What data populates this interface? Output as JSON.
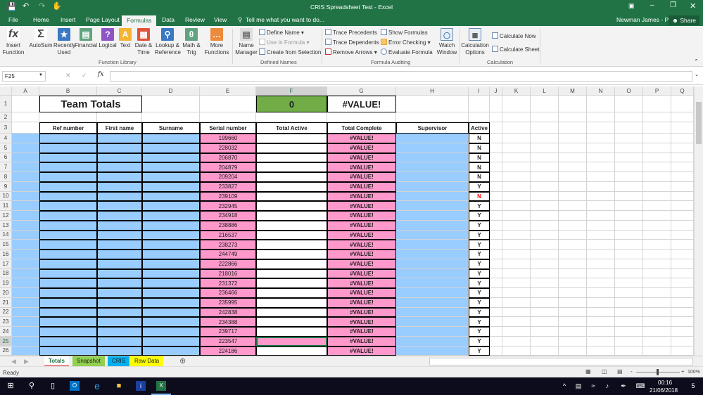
{
  "window": {
    "title": "CRIS Spreadsheet Test - Excel",
    "user": "Newman James - PY",
    "share": "Share"
  },
  "ribbon_tabs": [
    "File",
    "Home",
    "Insert",
    "Page Layout",
    "Formulas",
    "Data",
    "Review",
    "View"
  ],
  "active_tab": "Formulas",
  "tell_me": "Tell me what you want to do...",
  "function_library": {
    "label": "Function Library",
    "buttons": [
      {
        "label": "Insert\nFunction",
        "icon": "fx-icon",
        "color": "#ffffff"
      },
      {
        "label": "AutoSum",
        "icon": "sigma-icon",
        "color": "#ffffff"
      },
      {
        "label": "Recently\nUsed",
        "icon": "star-book-icon",
        "color": "#3a78c3"
      },
      {
        "label": "Financial",
        "icon": "financial-book-icon",
        "color": "#5fa37f"
      },
      {
        "label": "Logical",
        "icon": "question-book-icon",
        "color": "#8e55c7"
      },
      {
        "label": "Text",
        "icon": "text-book-icon",
        "color": "#f5b431"
      },
      {
        "label": "Date &\nTime",
        "icon": "calendar-book-icon",
        "color": "#e0533a"
      },
      {
        "label": "Lookup &\nReference",
        "icon": "magnifier-book-icon",
        "color": "#3a78c3"
      },
      {
        "label": "Math &\nTrig",
        "icon": "theta-book-icon",
        "color": "#5fa37f"
      },
      {
        "label": "More\nFunctions",
        "icon": "more-book-icon",
        "color": "#ec8b3c"
      }
    ]
  },
  "defined_names": {
    "label": "Defined Names",
    "name_manager": "Name\nManager",
    "define_name": "Define Name",
    "use_in_formula": "Use in Formula",
    "create_from_selection": "Create from Selection"
  },
  "formula_auditing": {
    "label": "Formula Auditing",
    "trace_precedents": "Trace Precedents",
    "trace_dependents": "Trace Dependents",
    "remove_arrows": "Remove Arrows",
    "show_formulas": "Show Formulas",
    "error_checking": "Error Checking",
    "evaluate_formula": "Evaluate Formula",
    "watch_window": "Watch\nWindow"
  },
  "calculation": {
    "label": "Calculation",
    "options": "Calculation\nOptions",
    "calc_now": "Calculate Now",
    "calc_sheet": "Calculate Sheet"
  },
  "formula_bar": {
    "name_box": "F25",
    "formula": ""
  },
  "columns": [
    "A",
    "B",
    "C",
    "D",
    "E",
    "F",
    "G",
    "H",
    "I",
    "J",
    "K",
    "L",
    "M",
    "N",
    "O",
    "P",
    "Q"
  ],
  "selected_cell": "F25",
  "sheet": {
    "title": "Team Totals",
    "total_active": "0",
    "total_complete": "#VALUE!",
    "headers": [
      "Ref number",
      "First name",
      "Surname",
      "Serial number",
      "Total Active",
      "Total Complete",
      "Supervisor",
      "Active"
    ],
    "rows": [
      {
        "serial": "199660",
        "complete": "#VALUE!",
        "active": "N"
      },
      {
        "serial": "228032",
        "complete": "#VALUE!",
        "active": "N"
      },
      {
        "serial": "206870",
        "complete": "#VALUE!",
        "active": "N"
      },
      {
        "serial": "204879",
        "complete": "#VALUE!",
        "active": "N"
      },
      {
        "serial": "209204",
        "complete": "#VALUE!",
        "active": "N"
      },
      {
        "serial": "233827",
        "complete": "#VALUE!",
        "active": "Y"
      },
      {
        "serial": "239109",
        "complete": "#VALUE!",
        "active": "N",
        "active_color": "#ff0000"
      },
      {
        "serial": "232945",
        "complete": "#VALUE!",
        "active": "Y"
      },
      {
        "serial": "234918",
        "complete": "#VALUE!",
        "active": "Y"
      },
      {
        "serial": "238886",
        "complete": "#VALUE!",
        "active": "Y"
      },
      {
        "serial": "216537",
        "complete": "#VALUE!",
        "active": "Y"
      },
      {
        "serial": "238273",
        "complete": "#VALUE!",
        "active": "Y"
      },
      {
        "serial": "244749",
        "complete": "#VALUE!",
        "active": "Y"
      },
      {
        "serial": "222866",
        "complete": "#VALUE!",
        "active": "Y"
      },
      {
        "serial": "218016",
        "complete": "#VALUE!",
        "active": "Y"
      },
      {
        "serial": "231372",
        "complete": "#VALUE!",
        "active": "Y"
      },
      {
        "serial": "236466",
        "complete": "#VALUE!",
        "active": "Y"
      },
      {
        "serial": "235995",
        "complete": "#VALUE!",
        "active": "Y"
      },
      {
        "serial": "242838",
        "complete": "#VALUE!",
        "active": "Y"
      },
      {
        "serial": "234388",
        "complete": "#VALUE!",
        "active": "Y"
      },
      {
        "serial": "239717",
        "complete": "#VALUE!",
        "active": "Y"
      },
      {
        "serial": "223547",
        "complete": "#VALUE!",
        "active": "Y"
      },
      {
        "serial": "224186",
        "complete": "#VALUE!",
        "active": "Y"
      }
    ]
  },
  "colors": {
    "excel_green": "#217346",
    "blue_fill": "#99ccff",
    "pink_fill": "#ff99cc",
    "total_green": "#70ad47"
  },
  "sheet_tabs": [
    {
      "label": "Totals",
      "color": "#ffffff",
      "active": true
    },
    {
      "label": "Snapshot",
      "color": "#92d050"
    },
    {
      "label": "CRIS",
      "color": "#00b0f0"
    },
    {
      "label": "Raw Data",
      "color": "#ffff00"
    }
  ],
  "status": {
    "text": "Ready",
    "zoom": "100%"
  },
  "taskbar": {
    "time": "00:16",
    "date": "21/06/2018",
    "notifications": "5"
  }
}
